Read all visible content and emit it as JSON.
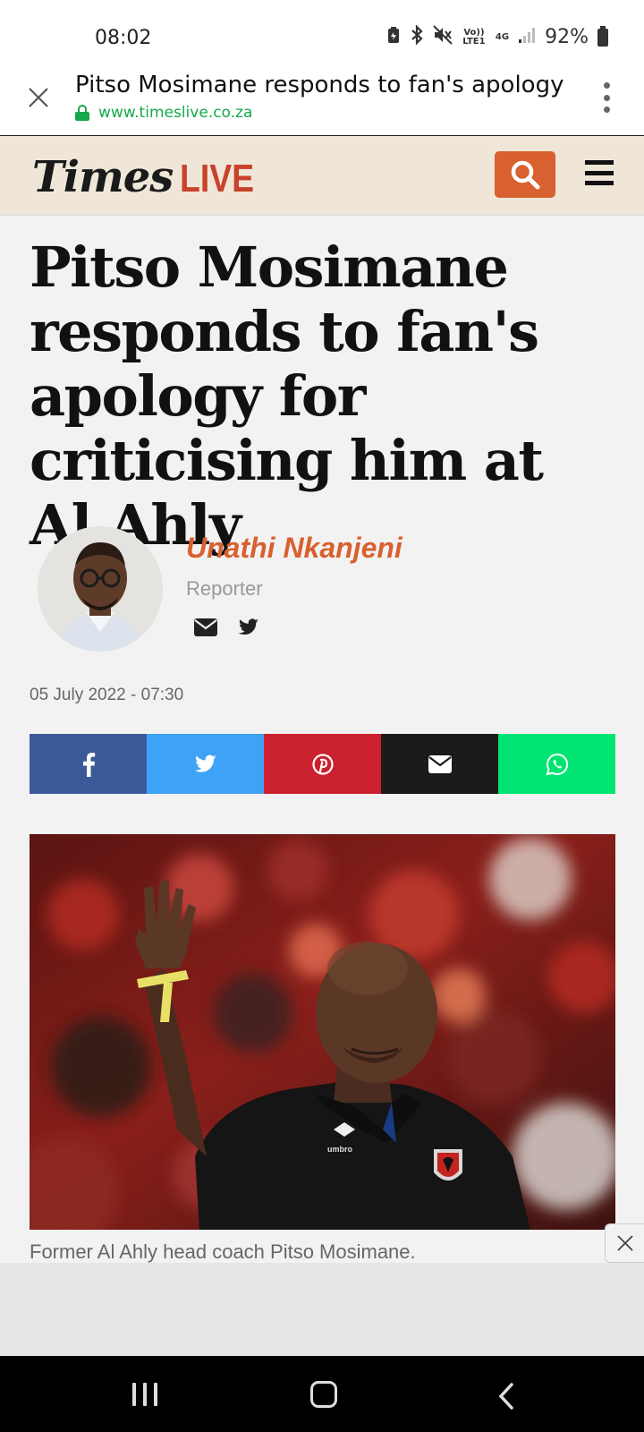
{
  "status_bar": {
    "time": "08:02",
    "network_label": "Vo)) LTE1",
    "network_type": "4G",
    "battery": "92%"
  },
  "browser": {
    "page_title": "Pitso Mosimane responds to fan's apology",
    "url": "www.timeslive.co.za"
  },
  "site": {
    "logo_times": "Times",
    "logo_live": "LIVE",
    "accent_color": "#d9602f"
  },
  "article": {
    "headline": "Pitso Mosimane responds to fan's apology for criticising him at Al Ahly",
    "author": {
      "name": "Unathi Nkanjeni",
      "role": "Reporter"
    },
    "date": "05 July 2022 - 07:30",
    "share": [
      {
        "network": "facebook",
        "icon": "facebook-icon",
        "color": "#3b5998"
      },
      {
        "network": "twitter",
        "icon": "twitter-icon",
        "color": "#3ea2f6"
      },
      {
        "network": "pinterest",
        "icon": "pinterest-icon",
        "color": "#cb202d"
      },
      {
        "network": "email",
        "icon": "envelope-icon",
        "color": "#1c1a1a"
      },
      {
        "network": "whatsapp",
        "icon": "whatsapp-icon",
        "color": "#00e571"
      }
    ],
    "image_caption": "Former Al Ahly head coach Pitso Mosimane."
  }
}
